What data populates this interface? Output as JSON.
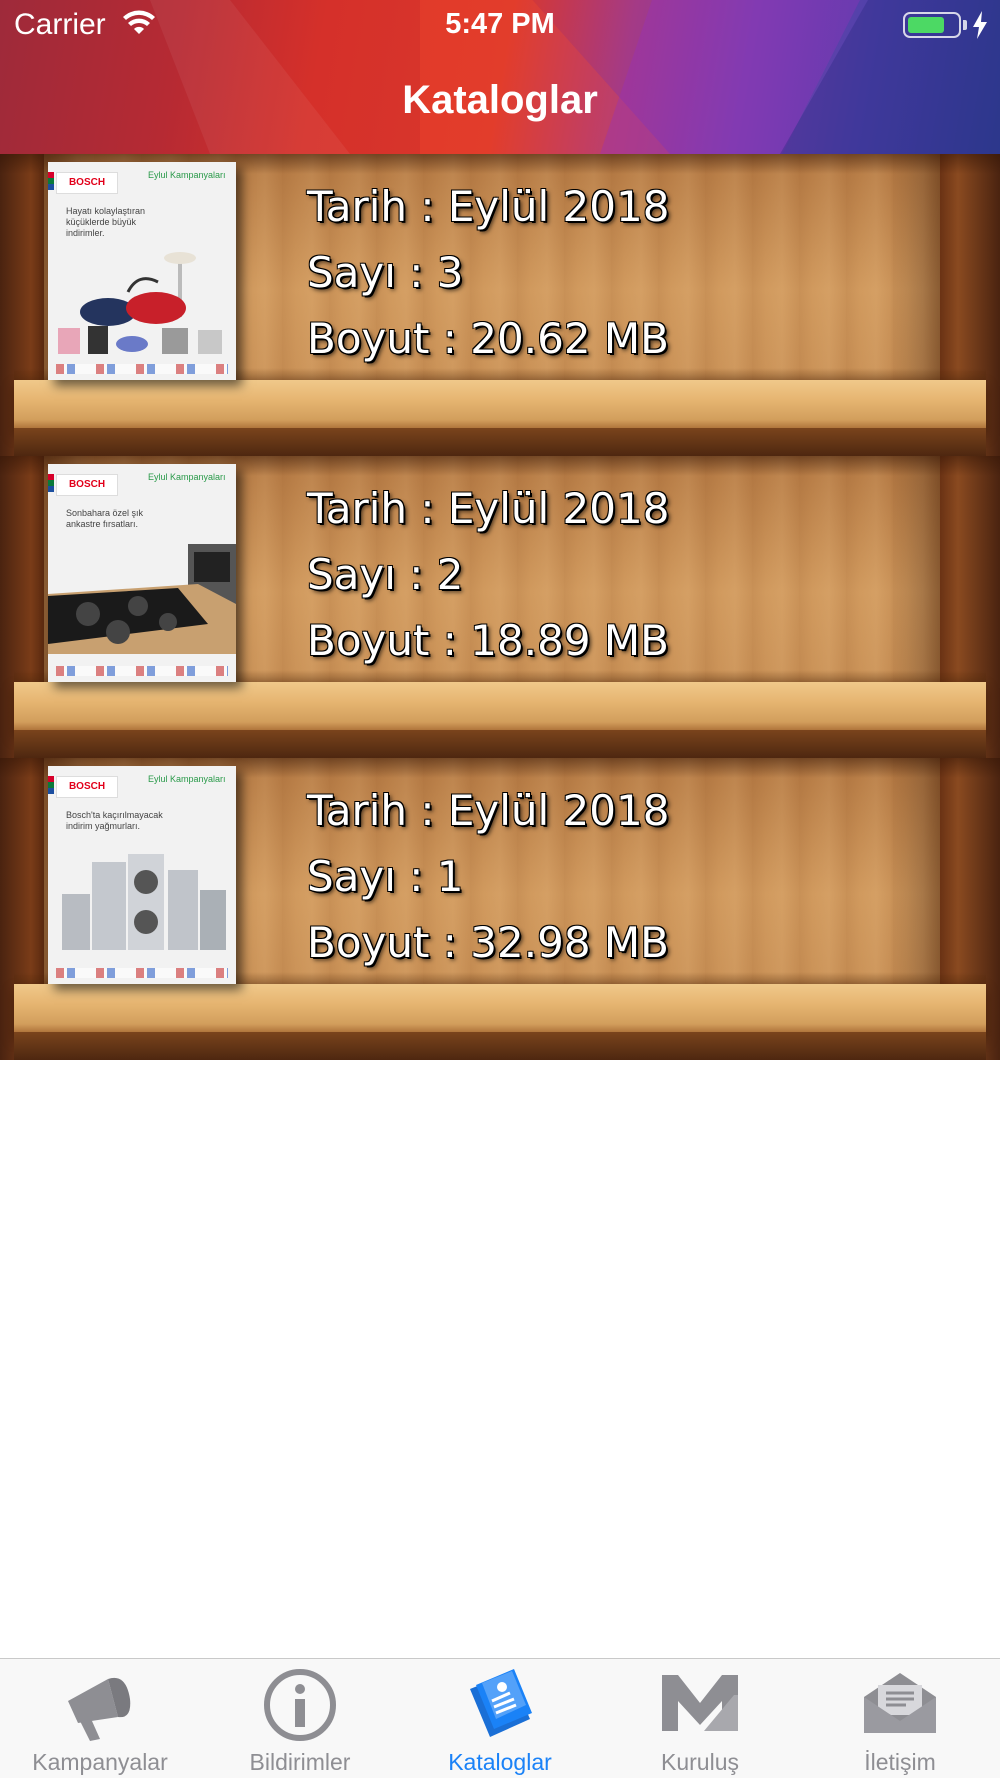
{
  "status_bar": {
    "carrier": "Carrier",
    "time": "5:47 PM",
    "battery_level": 0.75,
    "icons": [
      "wifi-icon",
      "battery-icon",
      "charging-bolt-icon"
    ]
  },
  "nav": {
    "title": "Kataloglar"
  },
  "catalogs": [
    {
      "cover": {
        "brand": "BOSCH",
        "campaign": "Eylul Kampanyaları",
        "tagline": "Hayatı kolaylaştıran küçüklerde büyük indirimler."
      },
      "date": "Tarih : Eylül 2018",
      "issue": "Sayı : 3",
      "size": "Boyut : 20.62 MB"
    },
    {
      "cover": {
        "brand": "BOSCH",
        "campaign": "Eylul Kampanyaları",
        "tagline": "Sonbahara özel şık ankastre fırsatları."
      },
      "date": "Tarih : Eylül 2018",
      "issue": "Sayı : 2",
      "size": "Boyut : 18.89 MB"
    },
    {
      "cover": {
        "brand": "BOSCH",
        "campaign": "Eylul Kampanyaları",
        "tagline": "Bosch'ta kaçırılmayacak indirim yağmurları."
      },
      "date": "Tarih : Eylül 2018",
      "issue": "Sayı : 1",
      "size": "Boyut : 32.98 MB"
    }
  ],
  "tab_bar": {
    "tabs": [
      {
        "label": "Kampanyalar",
        "icon": "megaphone-icon",
        "active": false
      },
      {
        "label": "Bildirimler",
        "icon": "info-icon",
        "active": false
      },
      {
        "label": "Kataloglar",
        "icon": "catalog-icon",
        "active": true
      },
      {
        "label": "Kuruluş",
        "icon": "company-logo-icon",
        "active": false
      },
      {
        "label": "İletişim",
        "icon": "envelope-icon",
        "active": false
      }
    ],
    "active_color": "#1a82f7",
    "inactive_color": "#8e8e93"
  }
}
